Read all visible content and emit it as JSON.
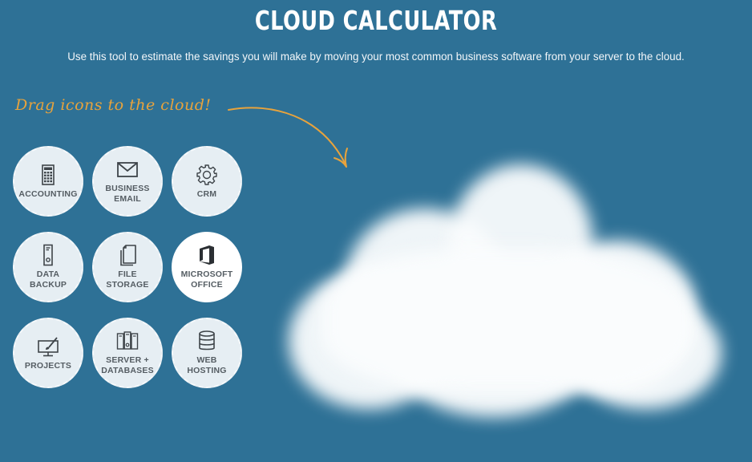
{
  "header": {
    "title": "CLOUD CALCULATOR",
    "subtitle": "Use this tool to estimate the savings you will make by moving your most common business software from your server to the cloud."
  },
  "hint": {
    "text": "Drag icons to the cloud!",
    "color": "#e8a33c"
  },
  "theme": {
    "background": "#2e7196",
    "tile_background": "#e6eef3",
    "tile_text": "#555d63"
  },
  "tiles": [
    {
      "label": "ACCOUNTING",
      "icon": "calculator-icon"
    },
    {
      "label": "BUSINESS\nEMAIL",
      "icon": "envelope-icon"
    },
    {
      "label": "CRM",
      "icon": "gear-icon"
    },
    {
      "label": "DATA\nBACKUP",
      "icon": "server-tower-icon"
    },
    {
      "label": "FILE\nSTORAGE",
      "icon": "documents-icon"
    },
    {
      "label": "MICROSOFT\nOFFICE",
      "icon": "office-logo-icon",
      "highlighted": true
    },
    {
      "label": "PROJECTS",
      "icon": "monitor-brush-icon"
    },
    {
      "label": "SERVER +\nDATABASES",
      "icon": "server-rack-icon"
    },
    {
      "label": "WEB\nHOSTING",
      "icon": "database-icon"
    }
  ],
  "drop_target": {
    "name": "cloud"
  }
}
